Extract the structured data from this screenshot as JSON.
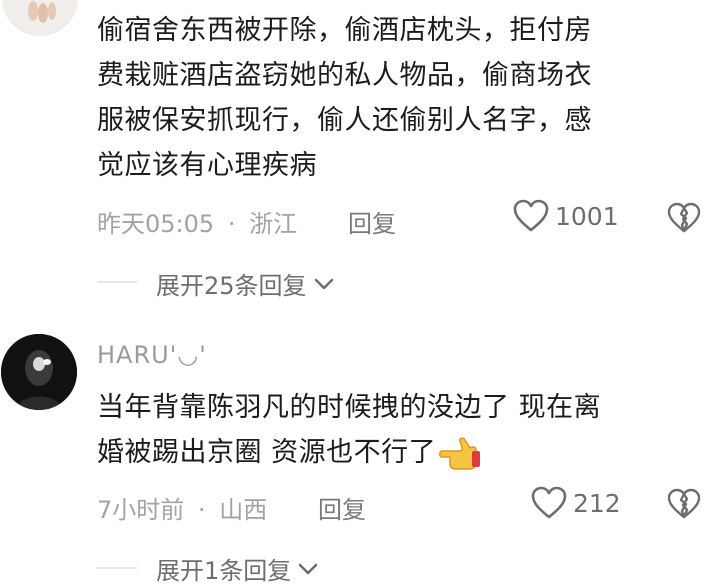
{
  "comments": [
    {
      "text_lines": [
        "偷宿舍东西被开除，偷酒店枕头，拒付房",
        "费栽赃酒店盗窃她的私人物品，偷商场衣",
        "服被保安抓现行，偷人还偷别人名字，感",
        "觉应该有心理疾病"
      ],
      "time": "昨天05:05",
      "location": "浙江",
      "separator": "·",
      "reply_label": "回复",
      "likes": "1001",
      "expand_label": "展开25条回复"
    },
    {
      "username": "HARU'◡'",
      "text_lines": [
        "当年背靠陈羽凡的时候拽的没边了 现在离",
        "婚被踢出京圈 资源也不行了"
      ],
      "emoji": "👉",
      "time": "7小时前",
      "location": "山西",
      "separator": "·",
      "reply_label": "回复",
      "likes": "212",
      "expand_label": "展开1条回复"
    }
  ],
  "colors": {
    "text": "#1c1c1c",
    "meta": "#a3a3a3",
    "icon": "#6e6e6e"
  },
  "icons": [
    "heart-icon",
    "broken-heart-icon",
    "chevron-down-icon",
    "hand-pointing-icon"
  ]
}
